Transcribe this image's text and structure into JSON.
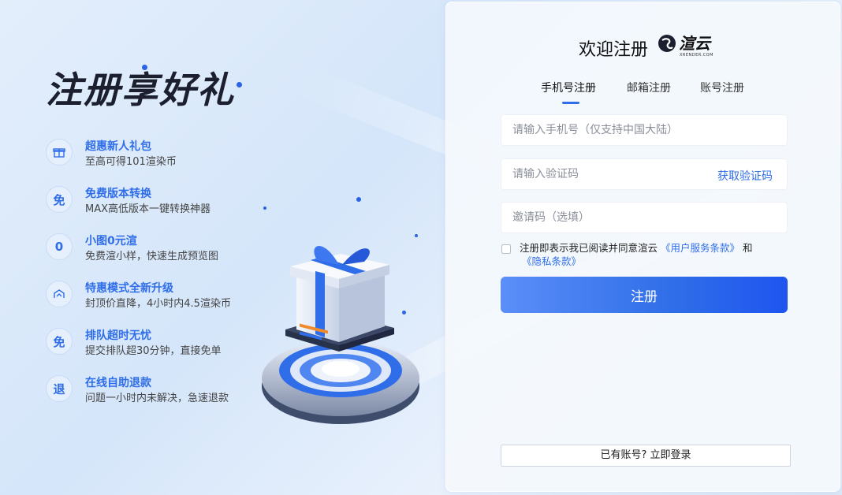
{
  "promo": {
    "title": "注册享好礼",
    "benefits": [
      {
        "icon": "gift-icon",
        "glyph": "🎁",
        "title": "超惠新人礼包",
        "desc": "至高可得101渲染币"
      },
      {
        "icon": "free-icon",
        "glyph": "免",
        "title": "免费版本转换",
        "desc": "MAX高低版本一键转换神器"
      },
      {
        "icon": "zero-icon",
        "glyph": "0",
        "title": "小图0元渲",
        "desc": "免费渲小样，快速生成预览图"
      },
      {
        "icon": "upgrade-icon",
        "glyph": "⇅",
        "title": "特惠模式全新升级",
        "desc": "封顶价直降，4小时内4.5渲染币"
      },
      {
        "icon": "free-icon",
        "glyph": "免",
        "title": "排队超时无忧",
        "desc": "提交排队超30分钟，直接免单"
      },
      {
        "icon": "refund-icon",
        "glyph": "退",
        "title": "在线自助退款",
        "desc": "问题一小时内未解决，急速退款"
      }
    ]
  },
  "card": {
    "title": "欢迎注册",
    "brand": {
      "name": "渲云",
      "sub": "XRENDER.COM"
    },
    "tabs": [
      "手机号注册",
      "邮箱注册",
      "账号注册"
    ],
    "active_tab": 0,
    "phone_placeholder": "请输入手机号（仅支持中国大陆）",
    "code_placeholder": "请输入验证码",
    "get_code_label": "获取验证码",
    "invite_placeholder": "邀请码（选填）",
    "agree_text": "注册即表示我已阅读并同意渲云",
    "terms_link": "《用户服务条款》",
    "and_text": "和",
    "privacy_link": "《隐私条款》",
    "submit_label": "注册",
    "login_label": "已有账号? 立即登录"
  },
  "colors": {
    "accent": "#2f6ee8",
    "title": "#1b1f2e"
  }
}
